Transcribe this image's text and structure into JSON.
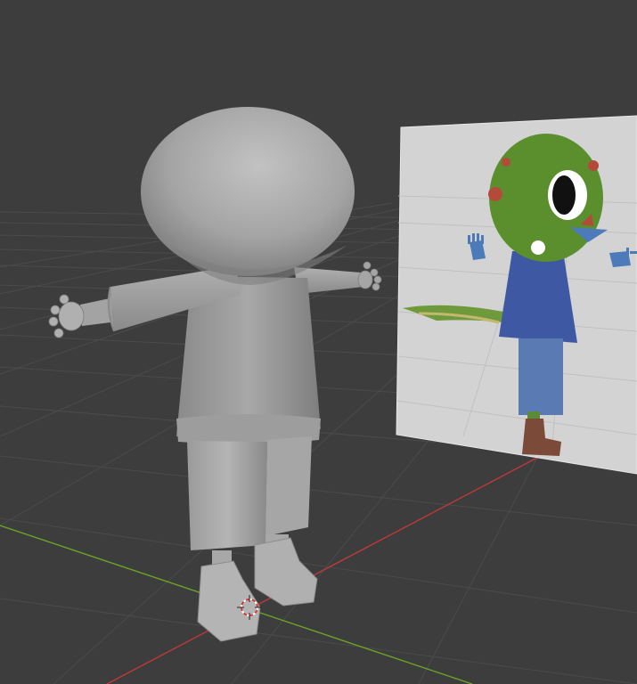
{
  "app": {
    "name": "3D viewport",
    "view": "perspective"
  },
  "viewport": {
    "background_color": "#3d3d3d",
    "grid_color": "#4a4a4a",
    "x_axis_color": "#c0393b",
    "y_axis_color": "#6aa527"
  },
  "scene": {
    "objects": [
      {
        "name": "character-mesh",
        "shading": "solid",
        "color": "#9a9a9a"
      },
      {
        "name": "reference-image-plane",
        "color": "#cfcfcf"
      }
    ],
    "cursor_icon": "3d-cursor-icon"
  }
}
